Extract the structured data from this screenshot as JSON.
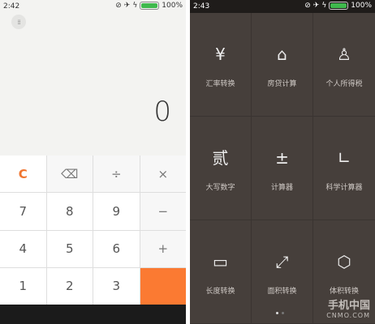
{
  "left": {
    "status": {
      "time": "2:42",
      "battery": "100%"
    },
    "display_value": "0",
    "keys": [
      {
        "label": "C",
        "kind": "clear"
      },
      {
        "label": "⌫",
        "kind": "op",
        "icon": "backspace-icon"
      },
      {
        "label": "÷",
        "kind": "op"
      },
      {
        "label": "×",
        "kind": "op"
      },
      {
        "label": "7",
        "kind": "num"
      },
      {
        "label": "8",
        "kind": "num"
      },
      {
        "label": "9",
        "kind": "num"
      },
      {
        "label": "−",
        "kind": "op"
      },
      {
        "label": "4",
        "kind": "num"
      },
      {
        "label": "5",
        "kind": "num"
      },
      {
        "label": "6",
        "kind": "num"
      },
      {
        "label": "+",
        "kind": "op"
      },
      {
        "label": "1",
        "kind": "num"
      },
      {
        "label": "2",
        "kind": "num"
      },
      {
        "label": "3",
        "kind": "num"
      },
      {
        "label": "",
        "kind": "orange"
      }
    ]
  },
  "right": {
    "status": {
      "time": "2:43",
      "battery": "100%"
    },
    "tools": [
      {
        "label": "汇率转换",
        "icon": "yen-icon",
        "glyph": "¥"
      },
      {
        "label": "房贷计算",
        "icon": "house-icon",
        "glyph": "⌂"
      },
      {
        "label": "个人所得税",
        "icon": "person-icon",
        "glyph": "♙"
      },
      {
        "label": "大写数字",
        "icon": "capital-number-icon",
        "glyph": "贰"
      },
      {
        "label": "计算器",
        "icon": "calculator-icon",
        "glyph": "±"
      },
      {
        "label": "科学计算器",
        "icon": "function-graph-icon",
        "glyph": "∟"
      },
      {
        "label": "长度转换",
        "icon": "ruler-icon",
        "glyph": "▭"
      },
      {
        "label": "面积转换",
        "icon": "area-icon",
        "glyph": "⤢"
      },
      {
        "label": "体积转换",
        "icon": "cube-icon",
        "glyph": "⬡"
      }
    ],
    "watermark": {
      "line1": "手机中国",
      "line2": "CNMO.COM"
    }
  }
}
